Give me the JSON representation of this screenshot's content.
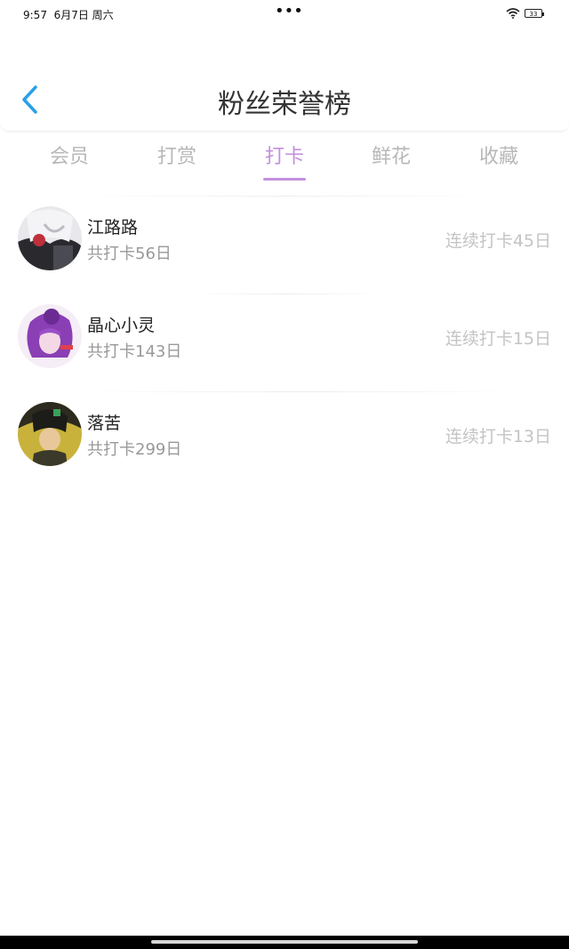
{
  "status_bar": {
    "time": "9:57",
    "date": "6月7日 周六",
    "dots": "•••",
    "battery": "33"
  },
  "header": {
    "title": "粉丝荣誉榜",
    "back_icon": "chevron-left-icon",
    "accent_color": "#29a0e8"
  },
  "tabs": [
    {
      "label": "会员",
      "active": false
    },
    {
      "label": "打赏",
      "active": false
    },
    {
      "label": "打卡",
      "active": true
    },
    {
      "label": "鲜花",
      "active": false
    },
    {
      "label": "收藏",
      "active": false
    }
  ],
  "active_tab_color": "#c290dc",
  "fans": [
    {
      "name": "江路路",
      "total": "共打卡56日",
      "streak": "连续打卡45日"
    },
    {
      "name": "晶心小灵",
      "total": "共打卡143日",
      "streak": "连续打卡15日"
    },
    {
      "name": "落苦",
      "total": "共打卡299日",
      "streak": "连续打卡13日"
    }
  ]
}
